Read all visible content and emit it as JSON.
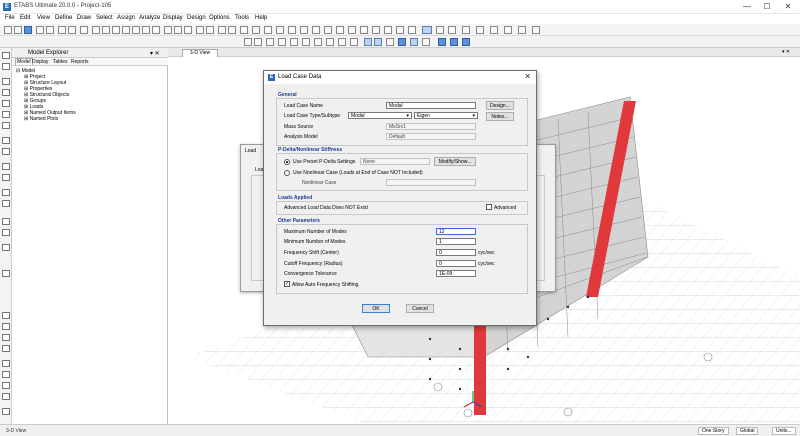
{
  "app": {
    "title": "ETABS Ultimate 20.0.0 - Project-105",
    "logo_letter": "E",
    "window_buttons": [
      "—",
      "☐",
      "✕"
    ]
  },
  "menu": [
    "File",
    "Edit",
    "View",
    "Define",
    "Draw",
    "Select",
    "Assign",
    "Analyze",
    "Display",
    "Design",
    "Options",
    "Tools",
    "Help"
  ],
  "explorer": {
    "title": "Model Explorer",
    "header_buttons": "▾ ✕",
    "tabs": [
      "Model",
      "Display",
      "Tables",
      "Reports"
    ],
    "tree": [
      "⊟ Model",
      "⊞ Project",
      "⊞ Structure Layout",
      "⊞ Properties",
      "⊞ Structural Objects",
      "⊞ Groups",
      "⊞ Loads",
      "⊞ Named Output Items",
      "⊞ Named Plots"
    ]
  },
  "view": {
    "tab_label": "3-D View",
    "header_buttons": "▾ ✕"
  },
  "status": {
    "left": "3-D View",
    "story": "One Story",
    "global": "Global",
    "units": "Units..."
  },
  "dialog": {
    "title": "Load Case Data",
    "logo_letter": "E",
    "close": "✕",
    "general": {
      "header": "General",
      "name_label": "Load Case Name",
      "name_value": "Modal",
      "design_button": "Design...",
      "type_label": "Load Case Type/Subtype",
      "type_value": "Modal",
      "subtype_value": "Eigen",
      "notes_button": "Notes...",
      "mass_label": "Mass Source",
      "mass_value": "MsSrc1",
      "analysis_label": "Analysis Model",
      "analysis_value": "Default"
    },
    "pdelta": {
      "header": "P-Delta/Nonlinear Stiffness",
      "preset_label": "Use Preset P-Delta Settings",
      "preset_value": "None",
      "modify_button": "Modify/Show...",
      "nonlinear_label": "Use Nonlinear Case  (Loads at End of Case NOT Included)",
      "nl_case_label": "Nonlinear Case",
      "nl_case_value": ""
    },
    "loads": {
      "header": "Loads Applied",
      "text": "Advanced Load Data Does NOT Exist",
      "advanced_label": "Advanced"
    },
    "other": {
      "header": "Other Parameters",
      "max_label": "Maximum Number of Modes",
      "max_value": "12",
      "min_label": "Minimum Number of Modes",
      "min_value": "1",
      "shift_label": "Frequency Shift  (Center)",
      "shift_value": "0",
      "shift_unit": "cyc/sec",
      "cutoff_label": "Cutoff Frequency  (Radius)",
      "cutoff_value": "0",
      "cutoff_unit": "cyc/sec",
      "tol_label": "Convergence Tolerance",
      "tol_value": "1E-09",
      "auto_shift_label": "Allow Auto Frequency Shifting"
    },
    "ok": "OK",
    "cancel": "Cancel"
  },
  "bg_dialog": {
    "title": "Load",
    "label": "Load"
  },
  "colors": {
    "column_red": "#e0383b",
    "accent": "#1e3d8f",
    "grid": "#7fa7c9"
  }
}
